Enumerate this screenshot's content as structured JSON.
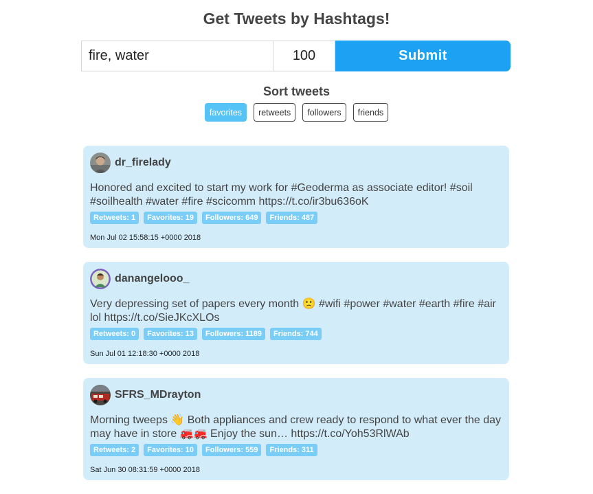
{
  "page": {
    "title": "Get Tweets by Hashtags!"
  },
  "form": {
    "hashtags_value": "fire, water",
    "count_value": "100",
    "submit_label": "Submit"
  },
  "sort": {
    "title": "Sort tweets",
    "options": [
      "favorites",
      "retweets",
      "followers",
      "friends"
    ],
    "active": "favorites"
  },
  "colors": {
    "accent": "#1da1f2",
    "card_bg": "#d2ecfa",
    "badge_bg": "#79cdf7"
  },
  "tweets": [
    {
      "username": "dr_firelady",
      "avatar_icon": "user-avatar-photo-icon",
      "text": "Honored and excited to start my work for #Geoderma as associate editor! #soil #soilhealth #water #fire #scicomm https://t.co/ir3bu636oK",
      "retweets": "Retweets: 1",
      "favorites": "Favorites: 19",
      "followers": "Followers: 649",
      "friends": "Friends: 487",
      "date": "Mon Jul 02 15:58:15 +0000 2018"
    },
    {
      "username": "danangelooo_",
      "avatar_icon": "user-avatar-photo-icon",
      "text": "Very depressing set of papers every month 🙁 #wifi #power #water #earth #fire #air lol https://t.co/SieJKcXLOs",
      "retweets": "Retweets: 0",
      "favorites": "Favorites: 13",
      "followers": "Followers: 1189",
      "friends": "Friends: 744",
      "date": "Sun Jul 01 12:18:30 +0000 2018"
    },
    {
      "username": "SFRS_MDrayton",
      "avatar_icon": "user-avatar-photo-icon",
      "text": "Morning tweeps 👋 Both appliances and crew ready to respond to what ever the day may have in store 🚒🚒 Enjoy the sun… https://t.co/Yoh53RlWAb",
      "retweets": "Retweets: 2",
      "favorites": "Favorites: 10",
      "followers": "Followers: 559",
      "friends": "Friends: 311",
      "date": "Sat Jun 30 08:31:59 +0000 2018"
    }
  ]
}
